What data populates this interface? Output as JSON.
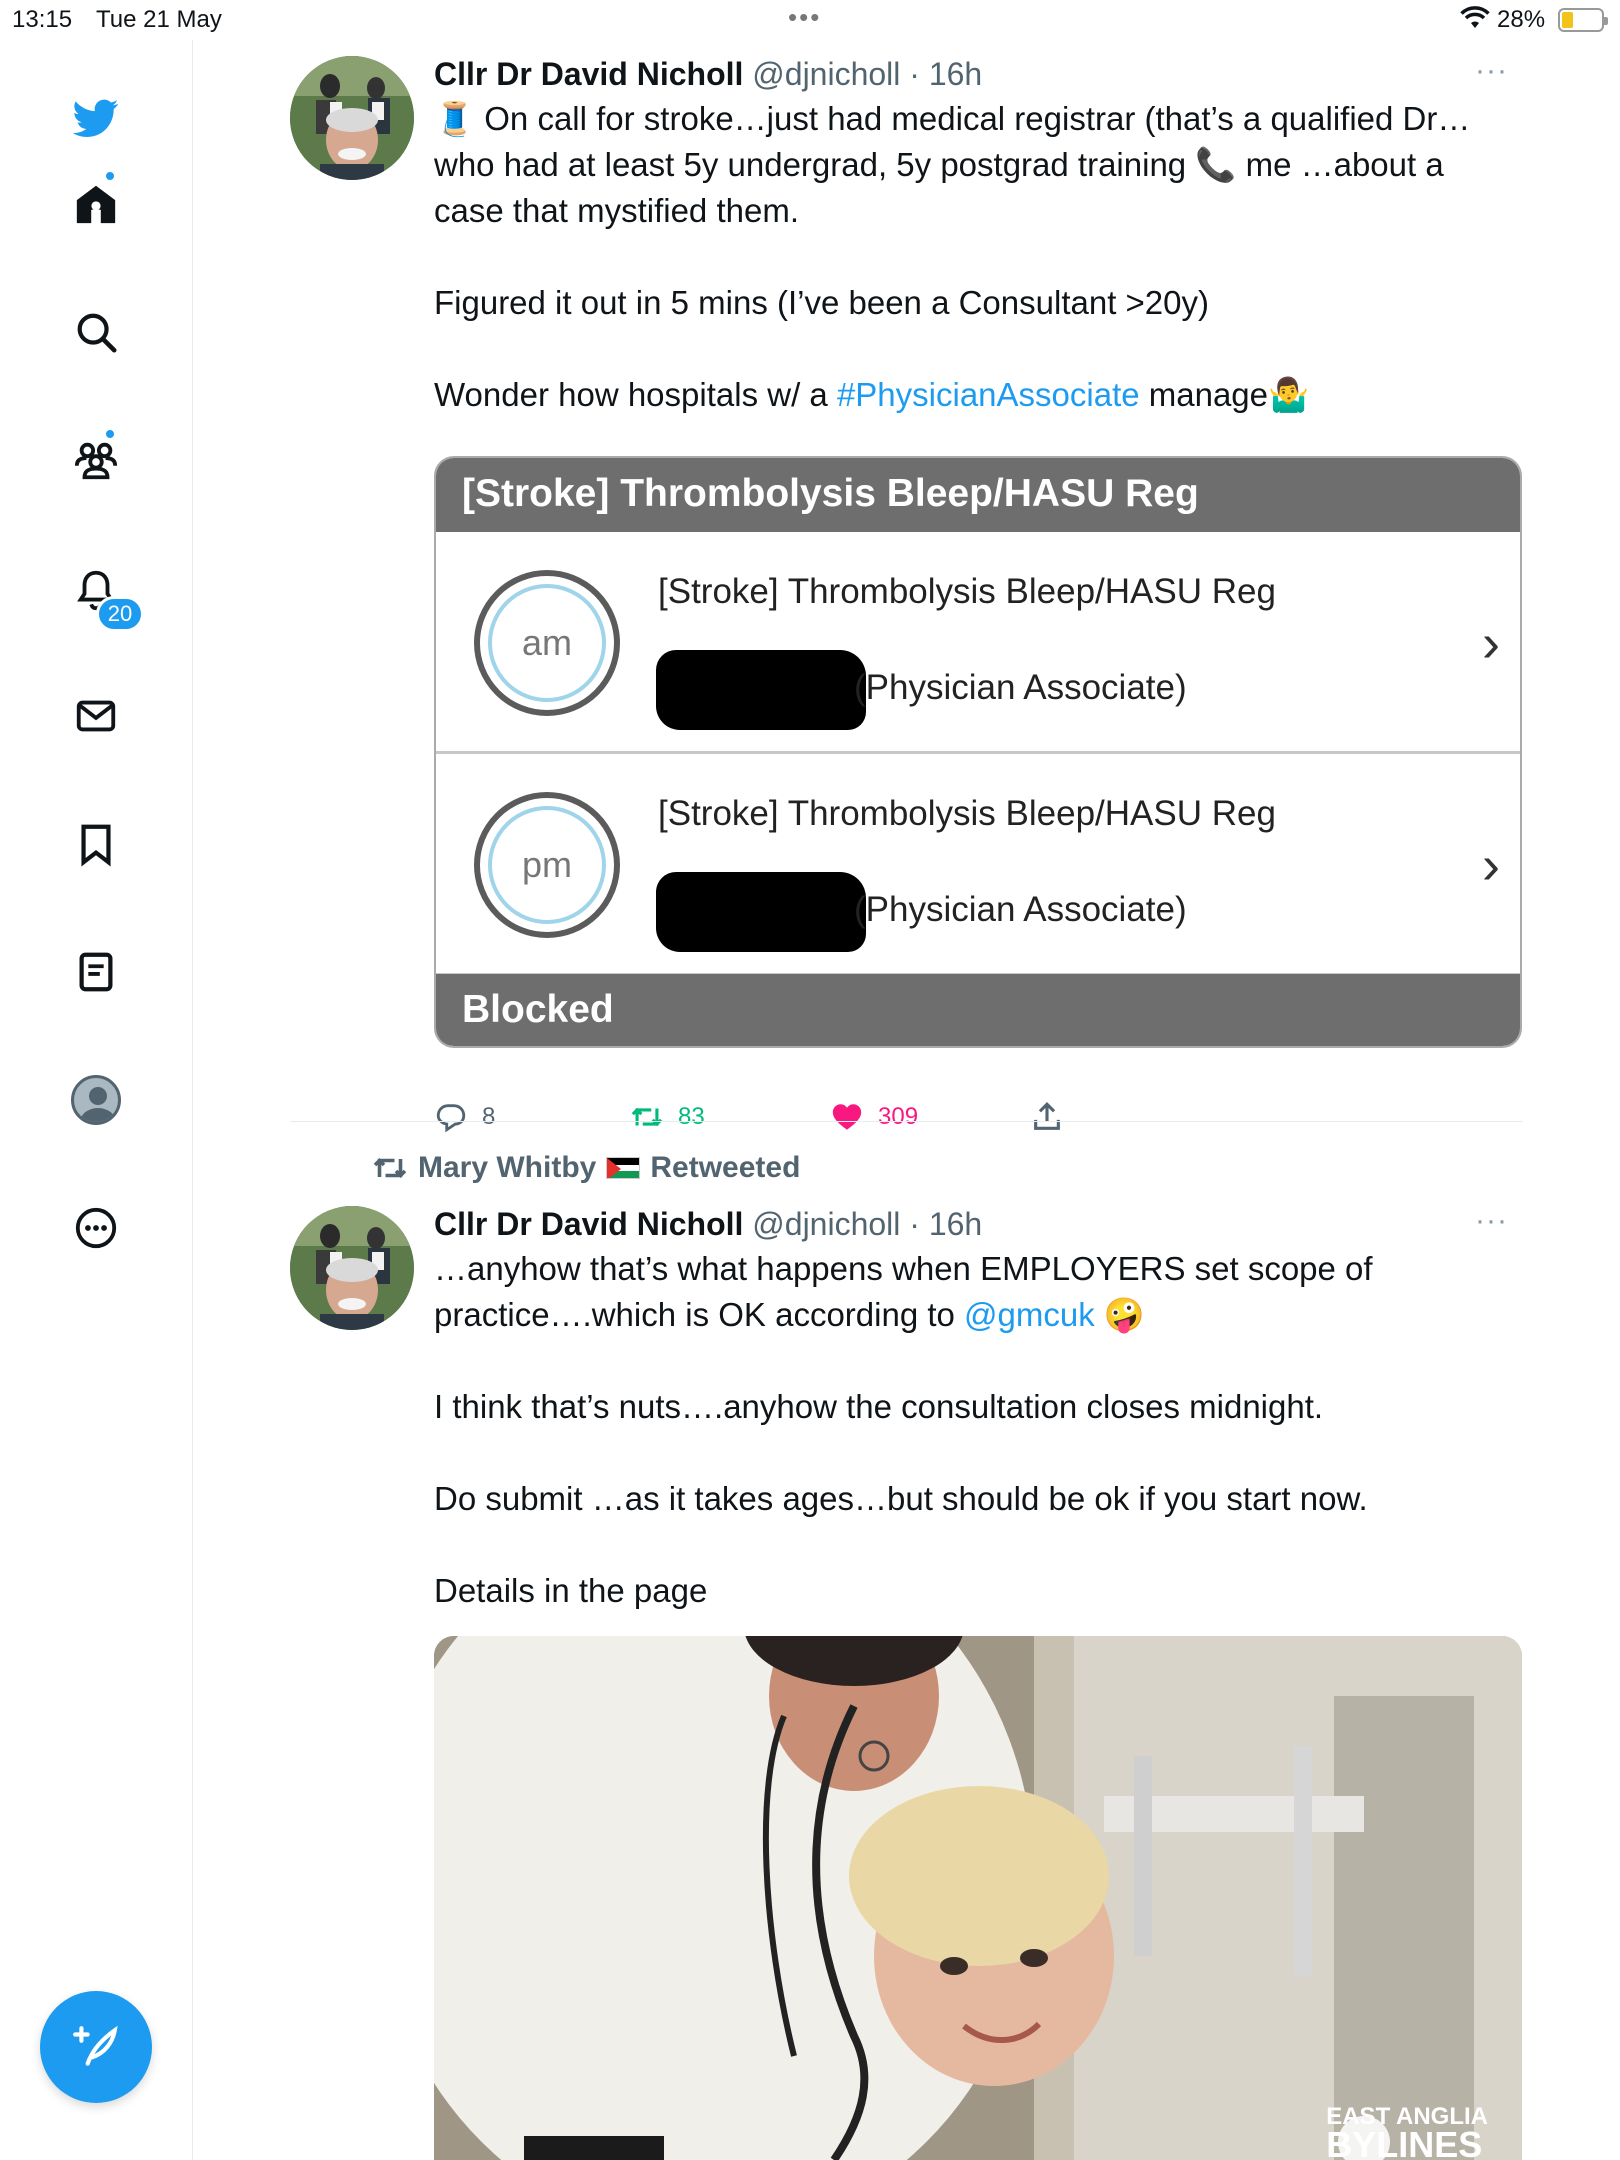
{
  "status_bar": {
    "time": "13:15",
    "date": "Tue 21 May",
    "battery": "28%",
    "battery_level": 0.28
  },
  "sidebar": {
    "items": [
      {
        "icon": "twitter-logo-icon"
      },
      {
        "icon": "home-icon",
        "dot": true
      },
      {
        "icon": "search-icon"
      },
      {
        "icon": "communities-icon",
        "dot": true
      },
      {
        "icon": "bell-icon",
        "badge": "20"
      },
      {
        "icon": "mail-icon"
      },
      {
        "icon": "bookmark-icon"
      },
      {
        "icon": "lists-icon"
      },
      {
        "icon": "profile-icon"
      },
      {
        "icon": "more-icon"
      }
    ],
    "notification_count": "20",
    "compose_icon": "compose-icon",
    "accent_color": "#1d9bf0"
  },
  "tweet1": {
    "name": "Cllr Dr David Nicholl",
    "handle": "@djnicholl",
    "separator": "·",
    "time": "16h",
    "more": "···",
    "lines": [
      "🧵 On call for stroke…just had medical registrar (that’s a qualified Dr…",
      "who had at least 5y undergrad, 5y postgrad training 📞 me …about a",
      "case that mystified them."
    ],
    "line2": "Figured it out in 5 mins (I’ve been a Consultant >20y)",
    "line3_pre": "Wonder how hospitals w/ a ",
    "line3_tag": "#PhysicianAssociate",
    "line3_post": " manage🤷‍♂️",
    "card": {
      "header": "[Stroke] Thrombolysis Bleep/HASU Reg",
      "rows": [
        {
          "circle": "am",
          "role": "[Stroke] Thrombolysis Bleep/HASU Reg",
          "person": "(Physician Associate)"
        },
        {
          "circle": "pm",
          "role": "[Stroke] Thrombolysis Bleep/HASU Reg",
          "person": "(Physician Associate)"
        }
      ],
      "footer": "Blocked"
    },
    "replies": "8",
    "retweets": "83",
    "likes": "309"
  },
  "retweet_context": {
    "user": "Mary Whitby",
    "label": "Retweeted"
  },
  "tweet2": {
    "name": "Cllr Dr David Nicholl",
    "handle": "@djnicholl",
    "separator": "·",
    "time": "16h",
    "more": "···",
    "line1a": "…anyhow that’s what happens when EMPLOYERS set scope of",
    "line1b_pre": "practice….which is OK according to ",
    "line1b_mention": "@gmcuk",
    "line1b_post": " 🤪",
    "line2": "I think that’s nuts….anyhow the consultation closes midnight.",
    "line3": "Do submit …as it takes ages…but should be ok if you start now.",
    "line4": "Details in the page",
    "photo_logo_top": "EAST ANGLIA",
    "photo_logo_bottom": "BYLINES"
  }
}
